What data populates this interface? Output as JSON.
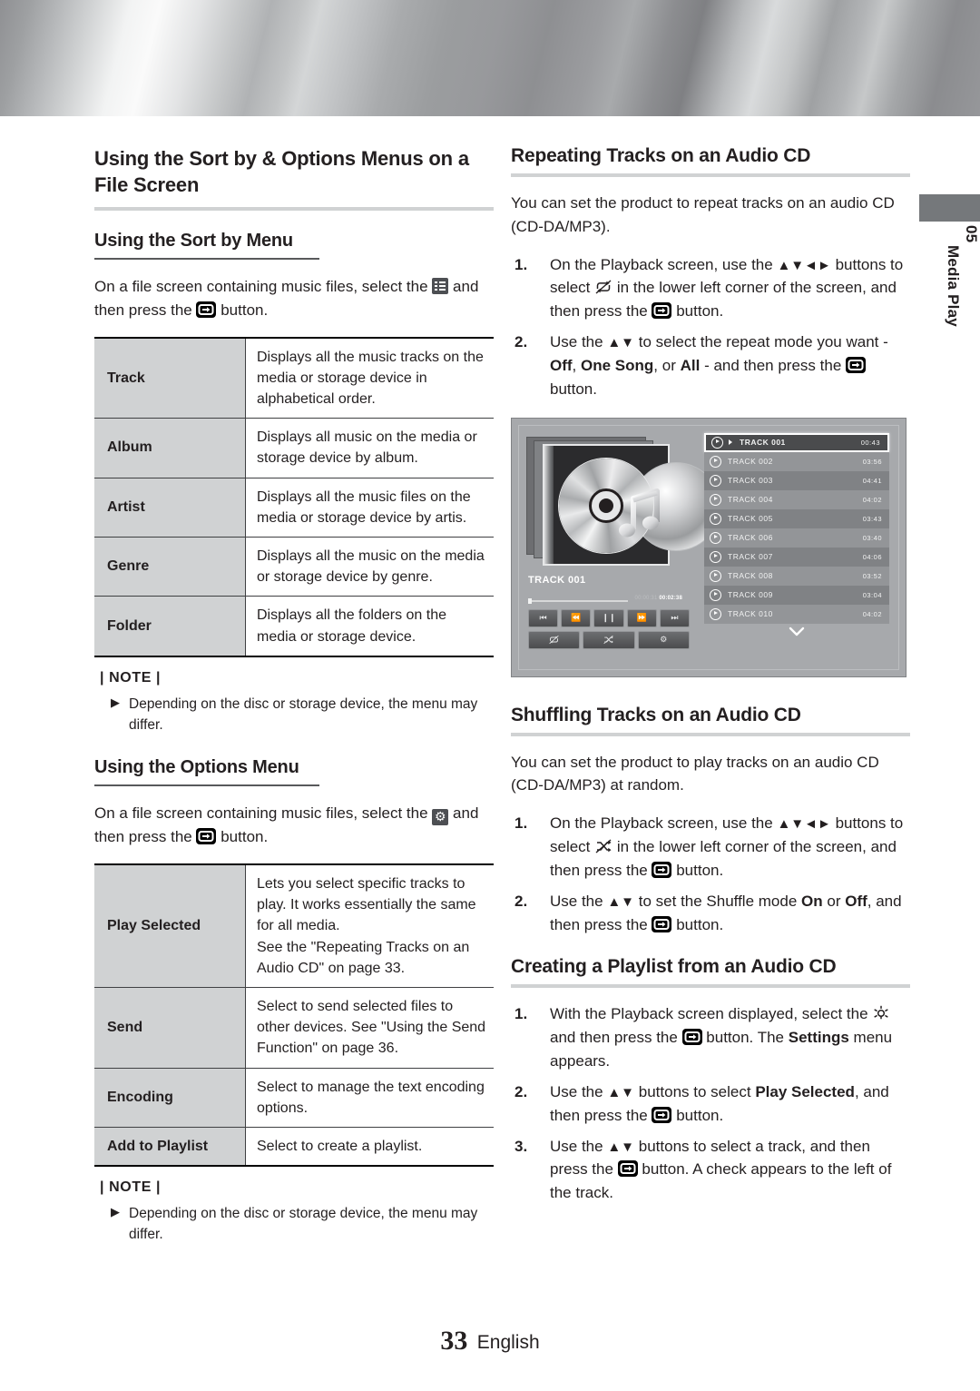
{
  "chapter_tab": {
    "number": "05",
    "name": "Media Play"
  },
  "footer": {
    "page": "33",
    "language": "English"
  },
  "left_column": {
    "section_title": "Using the Sort by & Options Menus on a File Screen",
    "sortby": {
      "heading": "Using the Sort by Menu",
      "intro_pre": "On a file screen containing music files, select the",
      "intro_mid": "and then press the",
      "intro_post": "button.",
      "rows": [
        {
          "key": "Track",
          "desc": "Displays all the music tracks on the media or storage device in alphabetical order."
        },
        {
          "key": "Album",
          "desc": "Displays all music on the media or storage device by album."
        },
        {
          "key": "Artist",
          "desc": "Displays all the music files on the media or storage device by artis."
        },
        {
          "key": "Genre",
          "desc": "Displays all the music on the media or storage device by genre."
        },
        {
          "key": "Folder",
          "desc": "Displays all the folders on the media or storage device."
        }
      ],
      "note_label": "| NOTE |",
      "note_items": [
        "Depending on the disc or storage device, the menu may differ."
      ]
    },
    "options": {
      "heading": "Using the Options Menu",
      "intro_pre": "On a file screen containing music files, select the",
      "intro_mid": "and then press the",
      "intro_post": "button.",
      "rows": [
        {
          "key": "Play Selected",
          "desc": "Lets you select specific tracks to play. It works essentially the same for all media.\nSee the \"Repeating Tracks on an Audio CD\" on page 33."
        },
        {
          "key": "Send",
          "desc": "Select to send selected files to other devices. See \"Using the Send Function\" on page 36."
        },
        {
          "key": "Encoding",
          "desc": "Select to manage the text encoding options."
        },
        {
          "key": "Add to Playlist",
          "desc": "Select to create a playlist."
        }
      ],
      "note_label": "| NOTE |",
      "note_items": [
        "Depending on the disc or storage device, the menu may differ."
      ]
    }
  },
  "right_column": {
    "repeating": {
      "heading": "Repeating Tracks on an Audio CD",
      "intro": "You can set the product to repeat tracks on an audio CD (CD-DA/MP3).",
      "steps": [
        {
          "num": "1.",
          "p1": "On the Playback screen, use the",
          "arrows": "▲▼◄►",
          "p2": "buttons to select",
          "p3": "in the lower left corner of the screen, and then press the",
          "p4": "button."
        },
        {
          "num": "2.",
          "p1": "Use the",
          "arrows": "▲▼",
          "p2": "to select the repeat mode you want -",
          "opt1": "Off",
          "sep1": ",",
          "opt2": "One Song",
          "sep2": ", or",
          "opt3": "All",
          "p3": "- and then press the",
          "p4": "button."
        }
      ]
    },
    "playback_figure": {
      "now_playing_label": "TRACK 001",
      "elapsed": "00:00:31",
      "total": "00:02:38",
      "transport_buttons": [
        "prev-track",
        "rewind",
        "pause",
        "fast-forward",
        "next-track"
      ],
      "mode_buttons": [
        "repeat",
        "shuffle",
        "settings"
      ],
      "tracks": [
        {
          "name": "TRACK 001",
          "time": "00:43",
          "selected": true
        },
        {
          "name": "TRACK 002",
          "time": "03:56",
          "selected": false
        },
        {
          "name": "TRACK 003",
          "time": "04:41",
          "selected": false
        },
        {
          "name": "TRACK 004",
          "time": "04:02",
          "selected": false
        },
        {
          "name": "TRACK 005",
          "time": "03:43",
          "selected": false
        },
        {
          "name": "TRACK 006",
          "time": "03:40",
          "selected": false
        },
        {
          "name": "TRACK 007",
          "time": "04:06",
          "selected": false
        },
        {
          "name": "TRACK 008",
          "time": "03:52",
          "selected": false
        },
        {
          "name": "TRACK 009",
          "time": "03:04",
          "selected": false
        },
        {
          "name": "TRACK 010",
          "time": "04:02",
          "selected": false
        }
      ]
    },
    "shuffling": {
      "heading": "Shuffling Tracks on an Audio CD",
      "intro": "You can set the product to play tracks on an audio CD (CD-DA/MP3) at random.",
      "steps": [
        {
          "num": "1.",
          "p1": "On the Playback screen, use the",
          "arrows": "▲▼◄►",
          "p2": "buttons to select",
          "p3": "in the lower left corner of the screen, and then press the",
          "p4": "button."
        },
        {
          "num": "2.",
          "p1": "Use the",
          "arrows": "▲▼",
          "p2": "to set the Shuffle mode",
          "opt1": "On",
          "sep1": "or",
          "opt2": "Off",
          "p3": ", and then press the",
          "p4": "button."
        }
      ]
    },
    "playlist": {
      "heading": "Creating a Playlist from an Audio CD",
      "steps": [
        {
          "num": "1.",
          "p1": "With the Playback screen displayed, select the",
          "p2": "and then press the",
          "p3": "button. The",
          "emph": "Settings",
          "p4": "menu appears."
        },
        {
          "num": "2.",
          "p1": "Use the",
          "arrows": "▲▼",
          "p2": "buttons to select",
          "emph": "Play Selected",
          "p3": ", and then press the",
          "p4": "button."
        },
        {
          "num": "3.",
          "p1": "Use the",
          "arrows": "▲▼",
          "p2": "buttons to select a track, and then press the",
          "p3": "button. A check appears to the left of the track."
        }
      ]
    }
  },
  "colors": {
    "table_key_bg": "#d0d2d3",
    "rule": "#58595b",
    "figure_bg": "#a7a9ac",
    "tab_cap": "#75787b"
  }
}
